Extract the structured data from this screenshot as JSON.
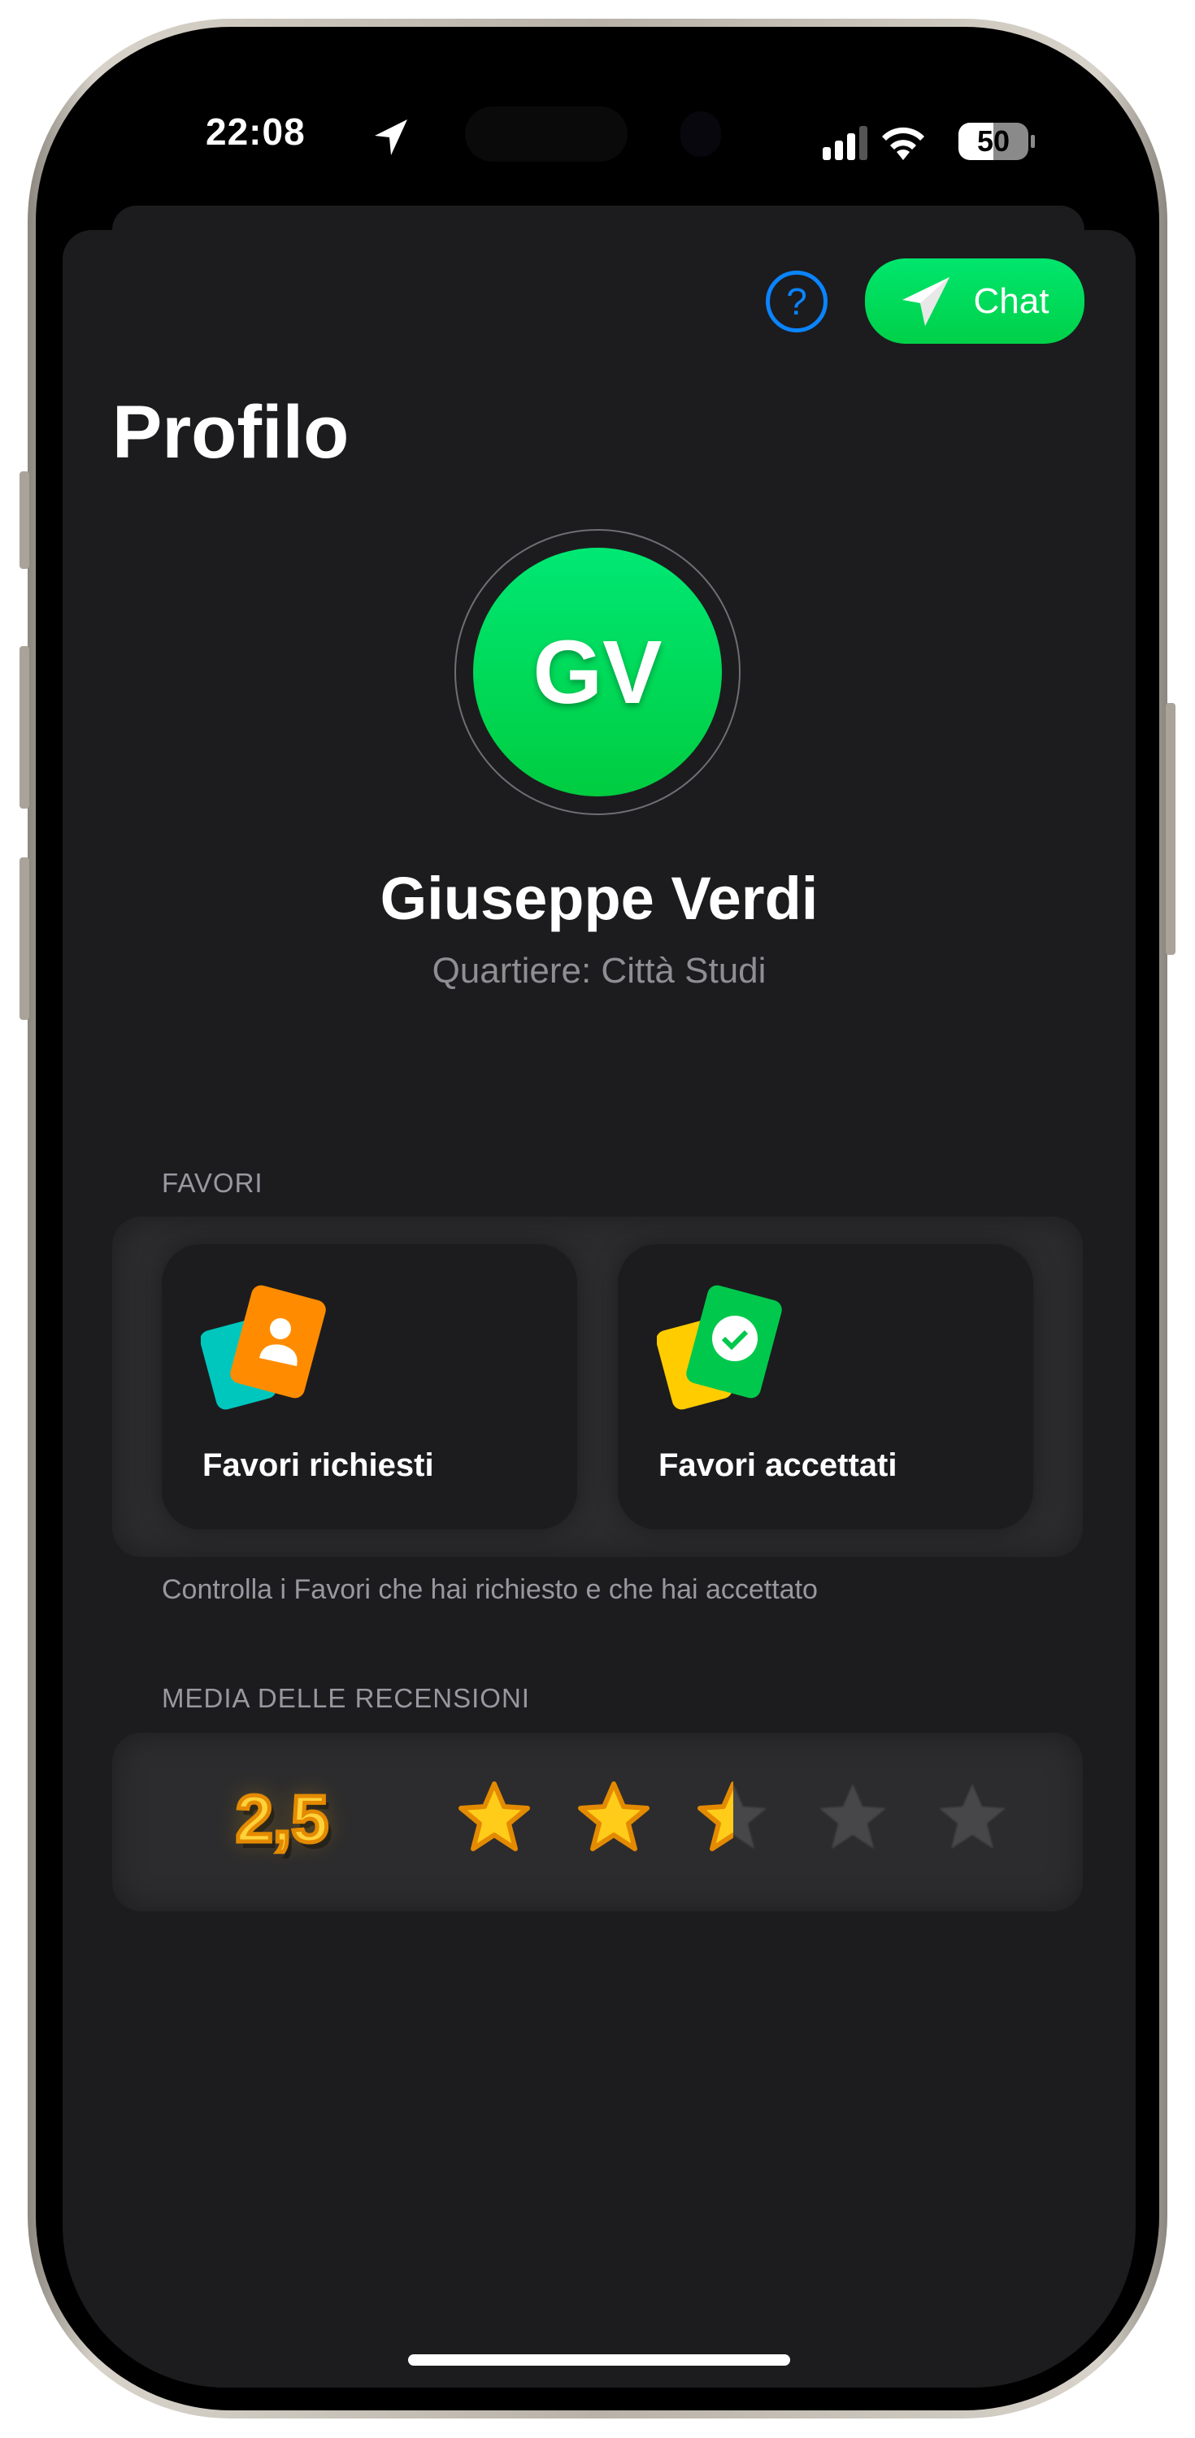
{
  "status_bar": {
    "time": "22:08",
    "battery": "50",
    "location_icon": "location-arrow-icon",
    "signal_icon": "cellular-signal-icon",
    "wifi_icon": "wifi-icon"
  },
  "toolbar": {
    "help_label": "?",
    "chat_label": "Chat"
  },
  "page_title": "Profilo",
  "profile": {
    "initials": "GV",
    "name": "Giuseppe Verdi",
    "neighborhood": "Quartiere: Città Studi",
    "avatar_color": "#00d84c"
  },
  "favori": {
    "header": "FAVORI",
    "cards": [
      {
        "label": "Favori richiesti",
        "icon": "requested-favors-icon"
      },
      {
        "label": "Favori accettati",
        "icon": "accepted-favors-icon"
      }
    ],
    "footer": "Controlla i Favori che hai richiesto e che hai accettato"
  },
  "reviews": {
    "header": "MEDIA DELLE RECENSIONI",
    "average": "2,5",
    "rating": 2.5,
    "max": 5
  },
  "colors": {
    "accent_green": "#00d84c",
    "help_blue": "#0a84ff",
    "background": "#1c1c1e",
    "star": "#ffc61a"
  }
}
